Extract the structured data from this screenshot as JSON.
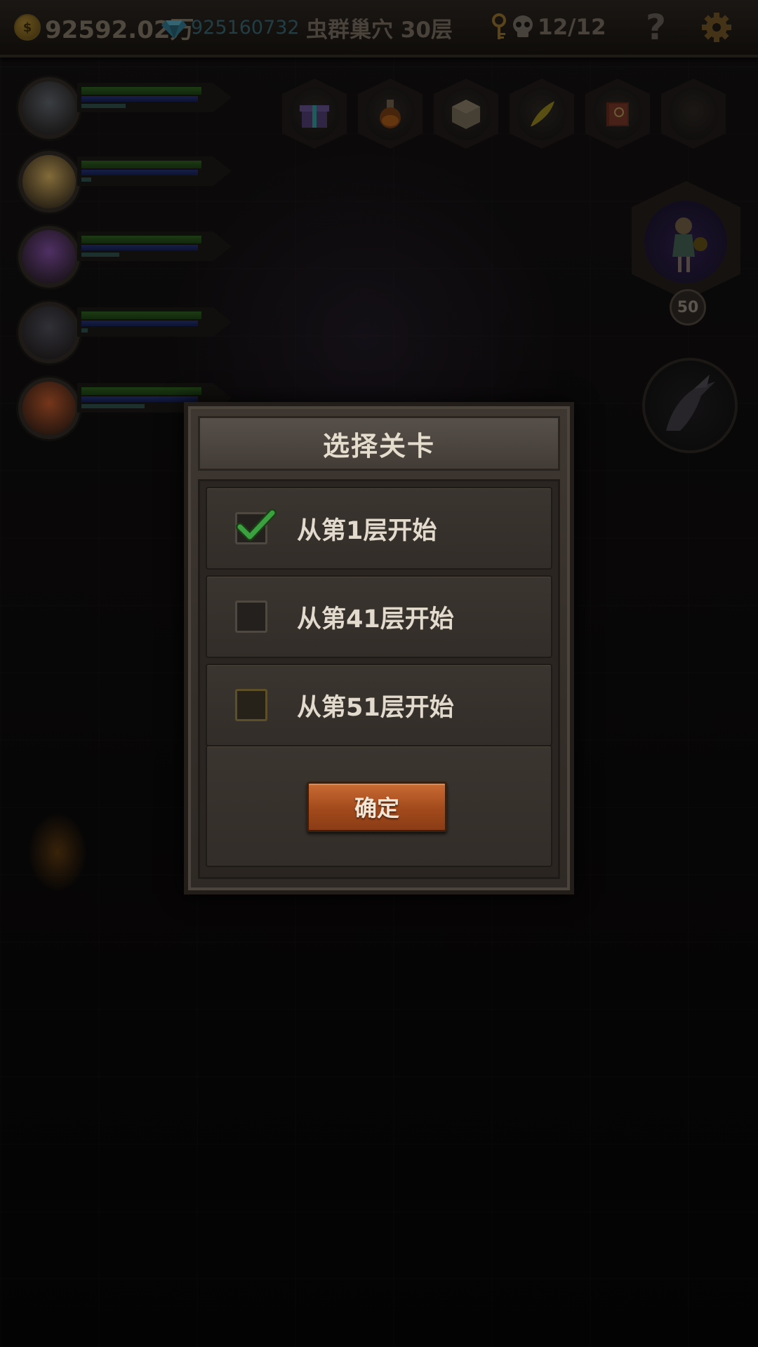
{
  "topbar": {
    "gold": "92592.02万",
    "gems": "925160732",
    "stage": "虫群巢穴 30层",
    "keys_skulls": "12/12",
    "help": "?"
  },
  "heroes": [
    {
      "id": "hero-1",
      "hp": 0.95,
      "mp": 0.92,
      "xp": 0.35,
      "portrait_color": "#5a5f66"
    },
    {
      "id": "hero-2",
      "hp": 0.95,
      "mp": 0.92,
      "xp": 0.08,
      "portrait_color": "#c9a55a"
    },
    {
      "id": "hero-3",
      "hp": 0.95,
      "mp": 0.92,
      "xp": 0.3,
      "portrait_color": "#7a4a9a"
    },
    {
      "id": "hero-4",
      "hp": 0.95,
      "mp": 0.92,
      "xp": 0.05,
      "portrait_color": "#4a4a55"
    },
    {
      "id": "hero-5",
      "hp": 0.95,
      "mp": 0.92,
      "xp": 0.5,
      "portrait_color": "#b5542a"
    }
  ],
  "item_slots": [
    "gift-box-icon",
    "potion-icon",
    "dice-icon",
    "feather-icon",
    "spellbook-icon",
    "empty-slot-icon"
  ],
  "boss": {
    "level": "50"
  },
  "dialog": {
    "title": "选择关卡",
    "options": [
      {
        "label": "从第1层开始",
        "checked": true
      },
      {
        "label": "从第41层开始",
        "checked": false
      },
      {
        "label": "从第51层开始",
        "checked": false
      }
    ],
    "confirm": "确定"
  },
  "colors": {
    "accent": "#b85a26",
    "check": "#3aa040",
    "hp": "#2c5a1f",
    "mp": "#232f6e"
  }
}
